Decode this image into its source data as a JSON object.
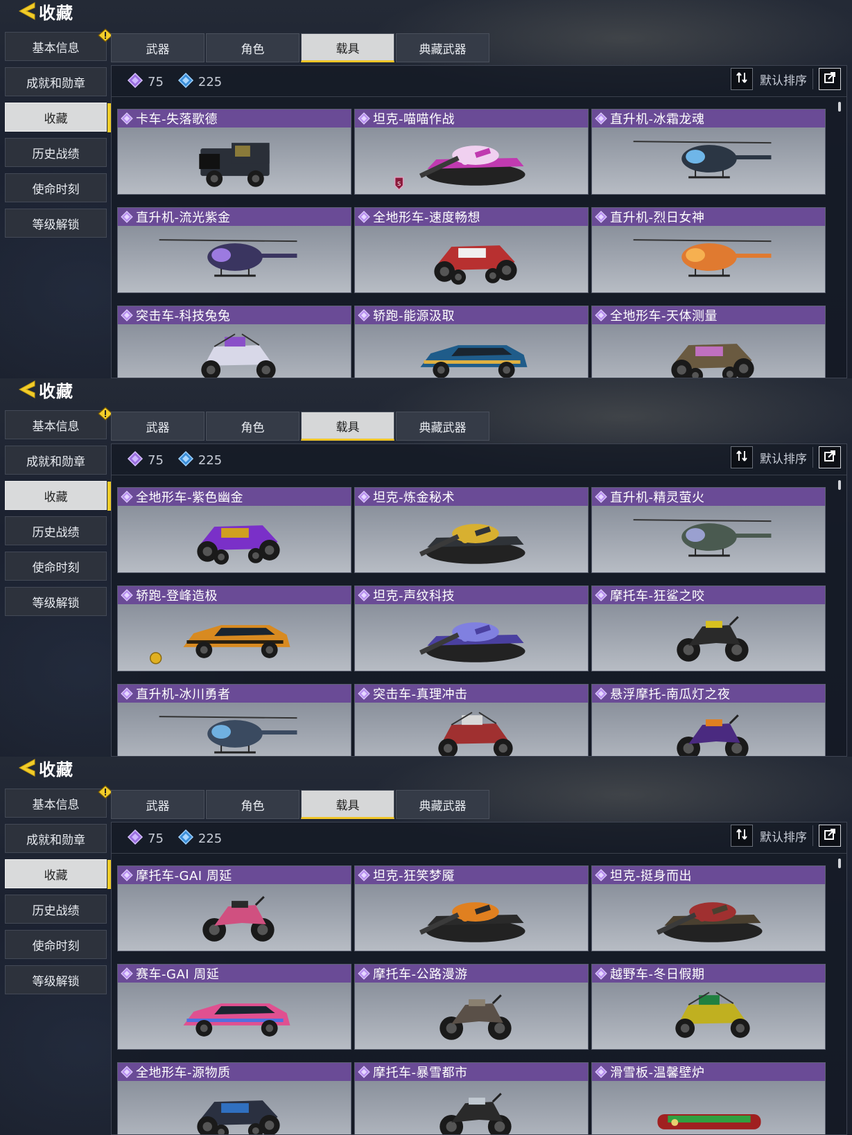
{
  "title": "收藏",
  "nav": [
    {
      "label": "基本信息",
      "alert": true
    },
    {
      "label": "成就和勋章",
      "alert": false
    },
    {
      "label": "收藏",
      "active": true
    },
    {
      "label": "历史战绩"
    },
    {
      "label": "使命时刻"
    },
    {
      "label": "等级解锁"
    }
  ],
  "tabs": [
    {
      "label": "武器"
    },
    {
      "label": "角色"
    },
    {
      "label": "载具",
      "active": true
    },
    {
      "label": "典藏武器"
    }
  ],
  "stats": {
    "purple": "75",
    "blue": "225"
  },
  "sort_label": "默认排序",
  "colors": {
    "accent": "#f2cd2a",
    "card_header": "#6a4b96",
    "active_tab": "#d6d7d8"
  },
  "panels": [
    {
      "cards": [
        {
          "name": "卡车-失落歌德",
          "kind": "truck",
          "c1": "#2a2f38",
          "c2": "#8a7a3a"
        },
        {
          "name": "坦克-喵喵作战",
          "kind": "tank",
          "c1": "#c03ab0",
          "c2": "#f0d0f0",
          "badge": "S"
        },
        {
          "name": "直升机-冰霜龙魂",
          "kind": "heli",
          "c1": "#2b3644",
          "c2": "#6fb6e8"
        },
        {
          "name": "直升机-流光紫金",
          "kind": "heli",
          "c1": "#3a3560",
          "c2": "#9c7ae0"
        },
        {
          "name": "全地形车-速度畅想",
          "kind": "atv",
          "c1": "#b83030",
          "c2": "#f0f0f0"
        },
        {
          "name": "直升机-烈日女神",
          "kind": "heli",
          "c1": "#e07a30",
          "c2": "#f6b050"
        },
        {
          "name": "突击车-科技兔兔",
          "kind": "buggy",
          "c1": "#d8d8e8",
          "c2": "#8a50c8"
        },
        {
          "name": "轿跑-能源汲取",
          "kind": "car",
          "c1": "#1f5c8a",
          "c2": "#e0b040"
        },
        {
          "name": "全地形车-天体测量",
          "kind": "atv",
          "c1": "#6a5a40",
          "c2": "#c070c0"
        }
      ]
    },
    {
      "cards": [
        {
          "name": "全地形车-紫色幽金",
          "kind": "atv",
          "c1": "#7a30c8",
          "c2": "#d0a020"
        },
        {
          "name": "坦克-炼金秘术",
          "kind": "tank",
          "c1": "#2f3338",
          "c2": "#d8b030"
        },
        {
          "name": "直升机-精灵萤火",
          "kind": "heli",
          "c1": "#4a5a50",
          "c2": "#9aa0d0"
        },
        {
          "name": "轿跑-登峰造极",
          "kind": "car",
          "c1": "#d88a20",
          "c2": "#2a2010",
          "badge": "G"
        },
        {
          "name": "坦克-声纹科技",
          "kind": "tank",
          "c1": "#4a40a0",
          "c2": "#8080e0"
        },
        {
          "name": "摩托车-狂鲨之咬",
          "kind": "moto",
          "c1": "#2a2a2a",
          "c2": "#d8c020"
        },
        {
          "name": "直升机-冰川勇者",
          "kind": "heli",
          "c1": "#3a4a60",
          "c2": "#70b0e0"
        },
        {
          "name": "突击车-真理冲击",
          "kind": "buggy",
          "c1": "#a03030",
          "c2": "#d8d8d8"
        },
        {
          "name": "悬浮摩托-南瓜灯之夜",
          "kind": "moto",
          "c1": "#4a2a80",
          "c2": "#e08020"
        }
      ]
    },
    {
      "cards": [
        {
          "name": "摩托车-GAI 周延",
          "kind": "moto",
          "c1": "#d05080",
          "c2": "#2a2a2a"
        },
        {
          "name": "坦克-狂笑梦魇",
          "kind": "tank",
          "c1": "#2a2a2a",
          "c2": "#e08020"
        },
        {
          "name": "坦克-挺身而出",
          "kind": "tank",
          "c1": "#4a4030",
          "c2": "#a03030"
        },
        {
          "name": "赛车-GAI 周延",
          "kind": "car",
          "c1": "#e05090",
          "c2": "#5070e0"
        },
        {
          "name": "摩托车-公路漫游",
          "kind": "moto",
          "c1": "#5a5048",
          "c2": "#8a8070"
        },
        {
          "name": "越野车-冬日假期",
          "kind": "buggy",
          "c1": "#c0b020",
          "c2": "#208040"
        },
        {
          "name": "全地形车-源物质",
          "kind": "atv",
          "c1": "#2a3040",
          "c2": "#3070c0"
        },
        {
          "name": "摩托车-暴雪都市",
          "kind": "moto",
          "c1": "#2a2a2a",
          "c2": "#c0c8d0"
        },
        {
          "name": "滑雪板-温馨壁炉",
          "kind": "sled",
          "c1": "#a02020",
          "c2": "#30a040"
        }
      ]
    }
  ]
}
